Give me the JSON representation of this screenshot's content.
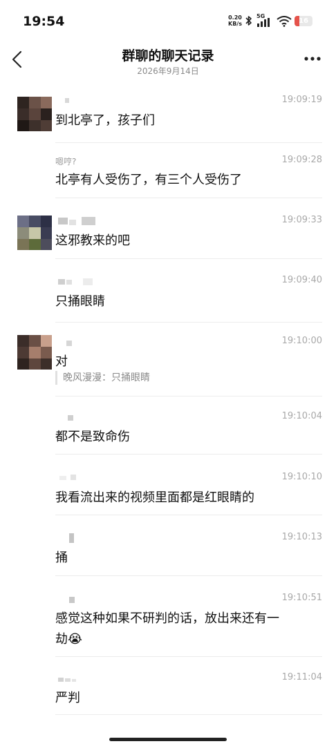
{
  "status_bar": {
    "time": "19:54",
    "net_speed_value": "0.20",
    "net_speed_unit": "KB/s",
    "network_type": "5G",
    "battery_level": "16",
    "battery_fraction": 0.16,
    "battery_color": "#e5534b",
    "icons": [
      "bluetooth-icon",
      "signal-icon",
      "wifi-icon",
      "battery-icon"
    ]
  },
  "header": {
    "title": "群聊的聊天记录",
    "date": "2026年9月14日",
    "back_icon": "chevron-left-icon",
    "more_icon": "more-horizontal-icon"
  },
  "messages": [
    {
      "sender": "",
      "time": "19:09:19",
      "text": "到北亭了，孩子们",
      "has_avatar": true
    },
    {
      "sender": "嗯哼?",
      "time": "19:09:28",
      "text": "北亭有人受伤了，有三个人受伤了",
      "has_avatar": false
    },
    {
      "sender": "",
      "time": "19:09:33",
      "text": "这邪教来的吧",
      "has_avatar": true
    },
    {
      "sender": "",
      "time": "19:09:40",
      "text": "只捅眼睛",
      "has_avatar": false
    },
    {
      "sender": "",
      "time": "19:10:00",
      "text": "对",
      "has_avatar": true,
      "quote": "晚风漫漫：只捅眼睛"
    },
    {
      "sender": "",
      "time": "19:10:04",
      "text": "都不是致命伤",
      "has_avatar": false
    },
    {
      "sender": "",
      "time": "19:10:10",
      "text": "我看流出来的视频里面都是红眼睛的",
      "has_avatar": false
    },
    {
      "sender": "",
      "time": "19:10:13",
      "text": "捅",
      "has_avatar": false
    },
    {
      "sender": "",
      "time": "19:10:51",
      "text": "感觉这种如果不研判的话，放出来还有一",
      "text_line2": "劫",
      "emoji": "😭",
      "has_avatar": false
    },
    {
      "sender": "",
      "time": "19:11:04",
      "text": "严判",
      "has_avatar": false
    }
  ]
}
